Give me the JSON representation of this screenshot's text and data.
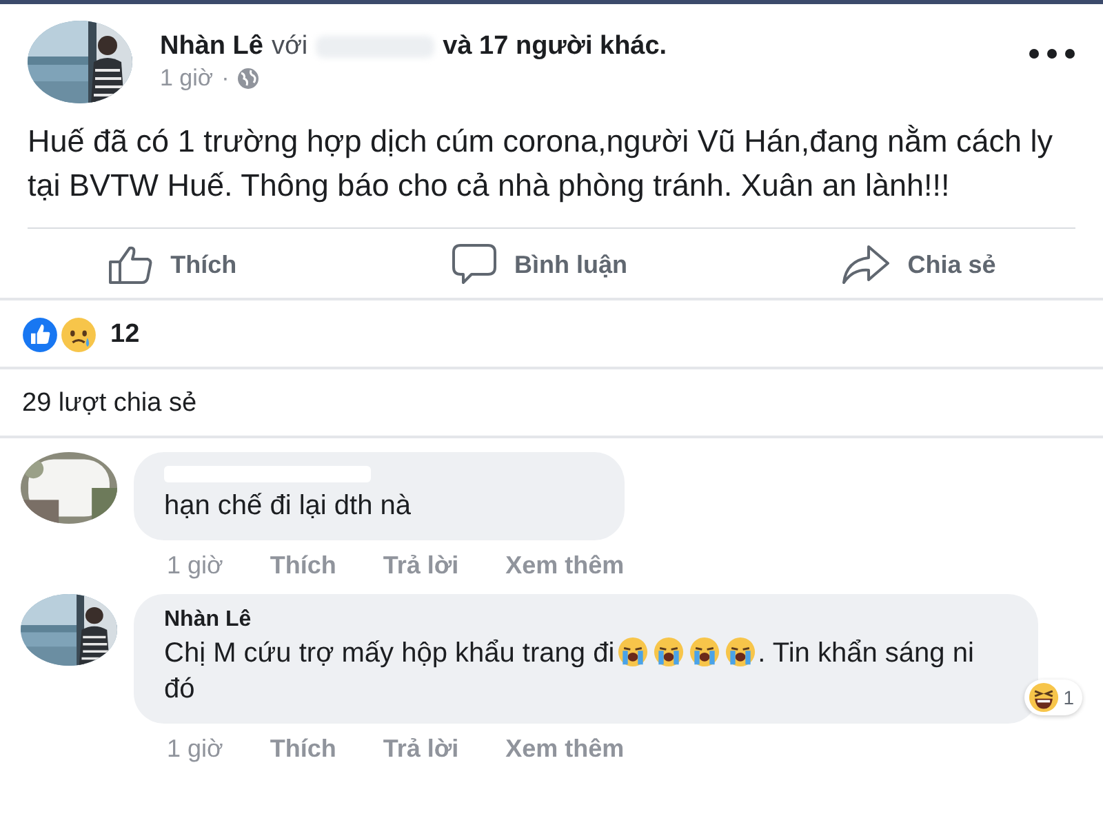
{
  "post": {
    "author": "Nhàn Lê",
    "with_word": "với",
    "tag_hidden": true,
    "tail": "và 17 người khác.",
    "time": "1 giờ",
    "time_separator": "·",
    "text": "Huế đã có 1 trường hợp dịch cúm corona,người Vũ Hán,đang nằm cách ly tại BVTW Huế. Thông báo cho cả nhà phòng tránh. Xuân an lành!!!",
    "actions": [
      {
        "kind": "like",
        "label": "Thích"
      },
      {
        "kind": "comment",
        "label": "Bình luận"
      },
      {
        "kind": "share",
        "label": "Chia sẻ"
      }
    ],
    "reactions": {
      "kinds": [
        {
          "kind": "like"
        },
        {
          "kind": "sad"
        }
      ],
      "count": "12"
    },
    "shares": "29 lượt chia sẻ"
  },
  "comments": [
    {
      "name_hidden": true,
      "parts": [
        {
          "kind": "text",
          "text": "hạn chế đi lại dth nà"
        }
      ],
      "time": "1 giờ",
      "actions": [
        "Thích",
        "Trả lời",
        "Xem thêm"
      ]
    },
    {
      "name_hidden": false,
      "author": "Nhàn Lê",
      "parts": [
        {
          "kind": "text",
          "text": "Chị M cứu trợ mấy hộp khẩu trang đi"
        },
        {
          "kind": "crying"
        },
        {
          "kind": "crying"
        },
        {
          "kind": "crying"
        },
        {
          "kind": "crying"
        },
        {
          "kind": "text",
          "text": ". Tin khẩn sáng ni đó"
        }
      ],
      "reaction": {
        "kind": "laughing",
        "count": "1"
      },
      "time": "1 giờ",
      "actions": [
        "Thích",
        "Trả lời",
        "Xem thêm"
      ]
    }
  ]
}
